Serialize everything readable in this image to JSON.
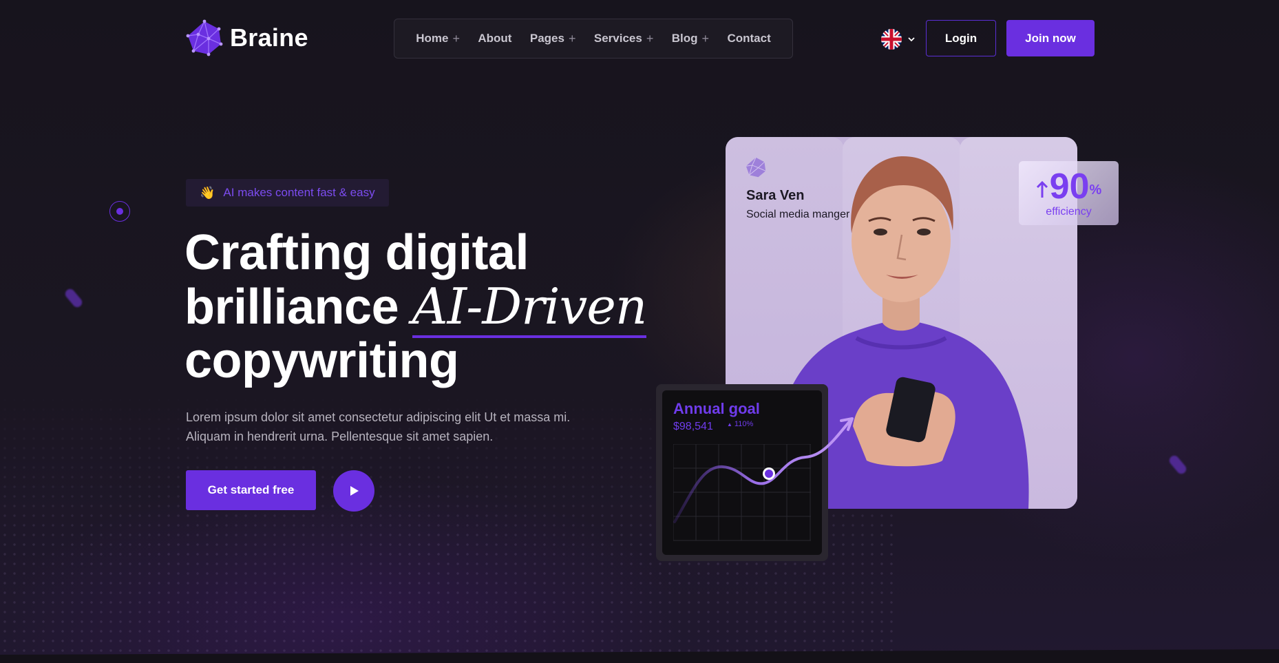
{
  "brand": {
    "name": "Braine",
    "accent_color": "#6a2fe0"
  },
  "nav": {
    "items": [
      {
        "label": "Home",
        "has_submenu": true
      },
      {
        "label": "About",
        "has_submenu": false
      },
      {
        "label": "Pages",
        "has_submenu": true
      },
      {
        "label": "Services",
        "has_submenu": true
      },
      {
        "label": "Blog",
        "has_submenu": true
      },
      {
        "label": "Contact",
        "has_submenu": false
      }
    ],
    "language_icon": "uk-flag-icon",
    "login_label": "Login",
    "join_label": "Join now"
  },
  "hero": {
    "badge_icon": "waving-hand-icon",
    "badge_text": "AI makes content fast & easy",
    "title_line1": "Crafting digital",
    "title_line2_start": "brilliance ",
    "title_accent": "AI-Driven",
    "title_line3": "copywriting",
    "description_line1": "Lorem ipsum dolor sit amet consectetur adipiscing elit Ut et massa mi.",
    "description_line2": "Aliquam in hendrerit urna. Pellentesque sit amet sapien.",
    "cta_label": "Get started free",
    "play_icon": "play-icon"
  },
  "profile_card": {
    "name": "Sara Ven",
    "role": "Social media manger",
    "efficiency_value": "90",
    "efficiency_unit": "%",
    "efficiency_label": "efficiency"
  },
  "goal_card": {
    "title": "Annual goal",
    "value": "$98,541",
    "change": "110%"
  }
}
